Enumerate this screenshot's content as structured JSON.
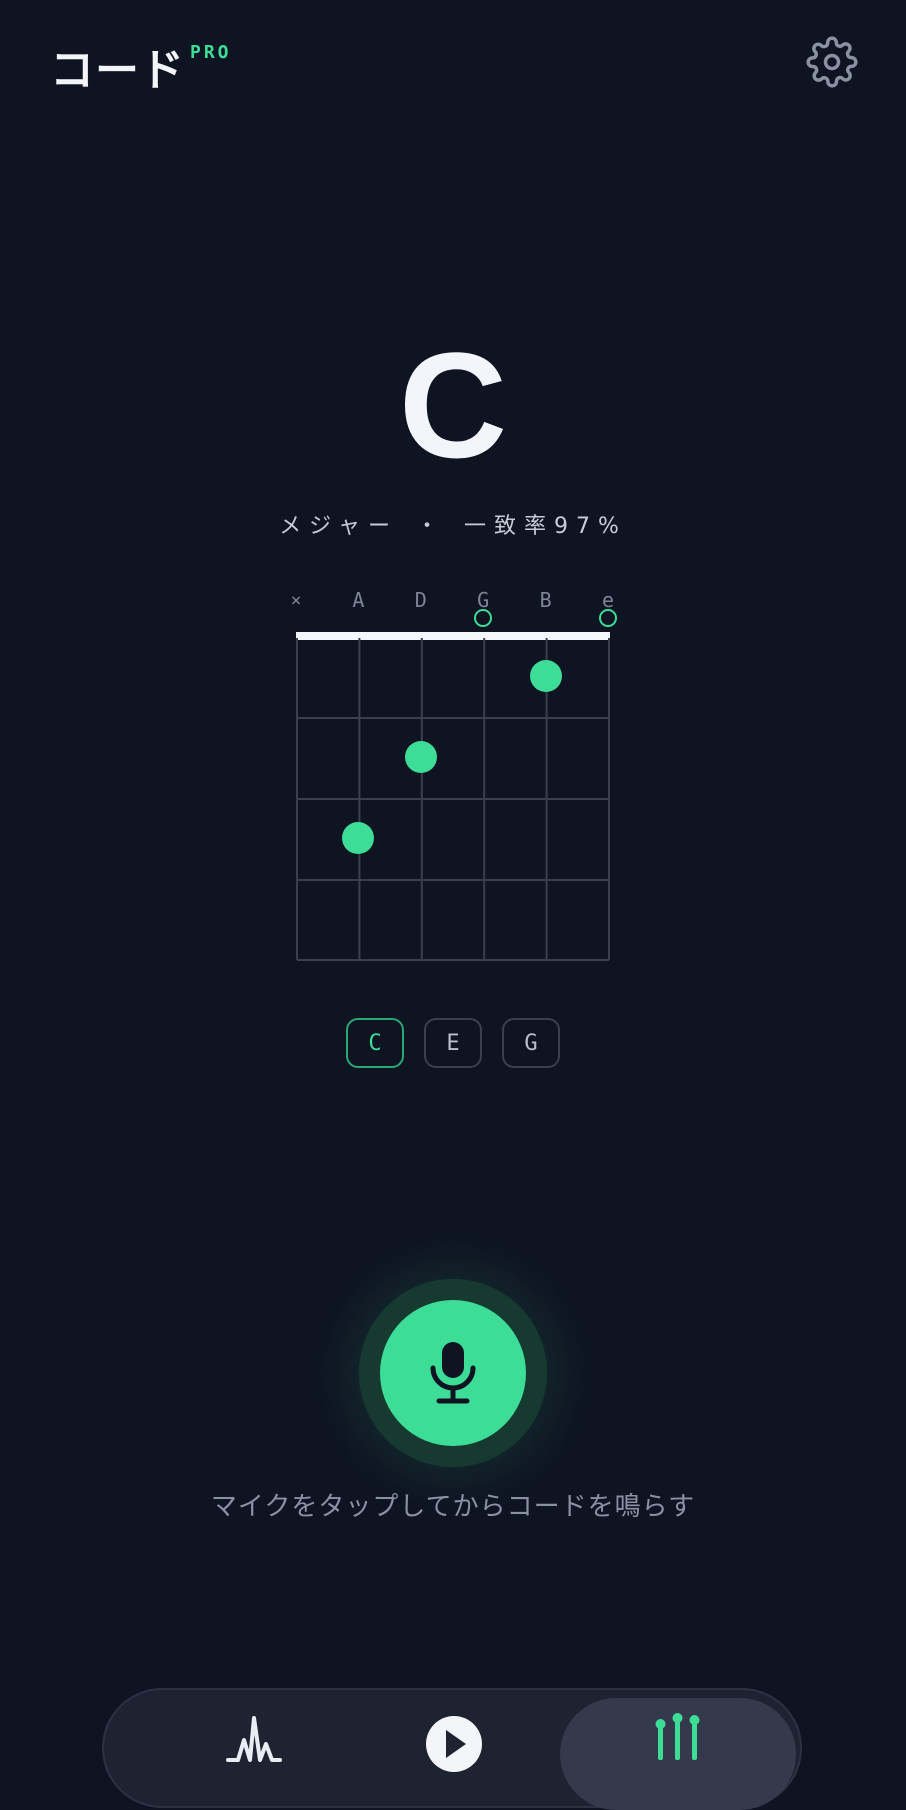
{
  "header": {
    "title": "コード",
    "badge": "PRO",
    "settings_icon": "gear-icon"
  },
  "chord": {
    "name": "C",
    "quality": "メジャー",
    "separator": "・",
    "match": "一致率97%"
  },
  "diagram": {
    "strings": [
      "×",
      "A",
      "D",
      "G",
      "B",
      "e"
    ],
    "open_strings": [
      "G",
      "e"
    ],
    "muted_strings": [
      "E"
    ],
    "frets_shown": 4,
    "fingers": [
      {
        "string": "B",
        "fret": 1
      },
      {
        "string": "D",
        "fret": 2
      },
      {
        "string": "A",
        "fret": 3
      }
    ]
  },
  "notes": [
    "C",
    "E",
    "G"
  ],
  "mic": {
    "icon": "microphone-icon",
    "hint": "マイクをタップしてからコードを鳴らす"
  },
  "tabbar": {
    "tabs": [
      {
        "icon": "waveform-icon",
        "active": false
      },
      {
        "icon": "play-icon",
        "active": false
      },
      {
        "icon": "tuner-sliders-icon",
        "active": true
      }
    ]
  },
  "colors": {
    "background": "#0f1422",
    "accent": "#3ddc97",
    "text": "#f3f5f9"
  }
}
